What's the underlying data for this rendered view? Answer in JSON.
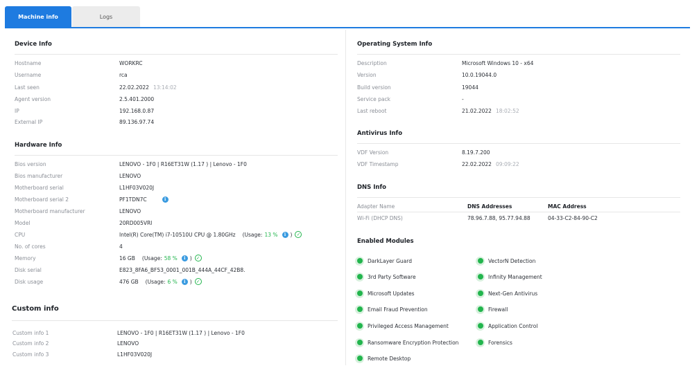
{
  "tabs": [
    {
      "label": "Machine info",
      "active": true
    },
    {
      "label": "Logs",
      "active": false
    }
  ],
  "device": {
    "title": "Device Info",
    "rows": [
      {
        "label": "Hostname",
        "value": "WORKRC"
      },
      {
        "label": "Username",
        "value": "rca"
      },
      {
        "label": "Last seen",
        "value": "22.02.2022",
        "time": "13:14:02"
      },
      {
        "label": "Agent version",
        "value": "2.5.401.2000"
      },
      {
        "label": "IP",
        "value": "192.168.0.87"
      },
      {
        "label": "External IP",
        "value": "89.136.97.74"
      }
    ]
  },
  "hardware": {
    "title": "Hardware Info",
    "rows": [
      {
        "label": "Bios version",
        "value": "LENOVO - 1F0 | R16ET31W (1.17 ) | Lenovo - 1F0"
      },
      {
        "label": "Bios manufacturer",
        "value": "LENOVO"
      },
      {
        "label": "Motherboard serial",
        "value": "L1HF03V020J"
      },
      {
        "label": "Motherboard serial 2",
        "value": "PF1TDN7C"
      },
      {
        "label": "Motherboard manufacturer",
        "value": "LENOVO"
      },
      {
        "label": "Model",
        "value": "20RD005VRI"
      },
      {
        "label": "CPU",
        "value": "Intel(R) Core(TM) i7-10510U CPU @ 1.80GHz",
        "usage_prefix": "(Usage:",
        "usage": "13 %",
        "usage_suffix": ")"
      },
      {
        "label": "No. of cores",
        "value": "4"
      },
      {
        "label": "Memory",
        "value": "16 GB",
        "usage_prefix": "(Usage:",
        "usage": "58 %",
        "usage_suffix": ")"
      },
      {
        "label": "Disk serial",
        "value": "E823_8FA6_BF53_0001_001B_444A_44CF_42B8."
      },
      {
        "label": "Disk usage",
        "value": "476 GB",
        "usage_prefix": "(Usage:",
        "usage": "6 %",
        "usage_suffix": ")"
      }
    ]
  },
  "custom": {
    "title": "Custom info",
    "rows": [
      {
        "label": "Custom info 1",
        "value": "LENOVO - 1F0 | R16ET31W (1.17 ) | Lenovo - 1F0"
      },
      {
        "label": "Custom info 2",
        "value": "LENOVO"
      },
      {
        "label": "Custom info 3",
        "value": "L1HF03V020J"
      }
    ]
  },
  "os": {
    "title": "Operating System Info",
    "rows": [
      {
        "label": "Description",
        "value": "Microsoft Windows 10 - x64"
      },
      {
        "label": "Version",
        "value": "10.0.19044.0"
      },
      {
        "label": "Build version",
        "value": "19044"
      },
      {
        "label": "Service pack",
        "value": "-"
      },
      {
        "label": "Last reboot",
        "value": "21.02.2022",
        "time": "18:02:52"
      }
    ]
  },
  "antivirus": {
    "title": "Antivirus Info",
    "rows": [
      {
        "label": "VDF Version",
        "value": "8.19.7.200"
      },
      {
        "label": "VDF Timestamp",
        "value": "22.02.2022",
        "time": "09:09:22"
      }
    ]
  },
  "dns": {
    "title": "DNS Info",
    "headers": {
      "adapter": "Adapter Name",
      "dns": "DNS Addresses",
      "mac": "MAC Address"
    },
    "row": {
      "adapter": "Wi-Fi (DHCP DNS)",
      "dns": "78.96.7.88, 95.77.94.88",
      "mac": "04-33-C2-84-90-C2"
    }
  },
  "modules": {
    "title": "Enabled Modules",
    "left": [
      "DarkLayer Guard",
      "3rd Party Software",
      "Microsoft Updates",
      "Email Fraud Prevention",
      "Privileged Access Management",
      "Ransomware Encryption Protection",
      "Remote Desktop"
    ],
    "right": [
      "VectorN Detection",
      "Infinity Management",
      "Next-Gen Antivirus",
      "Firewall",
      "Application Control",
      "Forensics"
    ]
  },
  "icons": {
    "info": "info-icon",
    "check": "check-circle-icon",
    "module": "green-dot-icon"
  },
  "colors": {
    "accent": "#1e7be0",
    "success": "#22b54d",
    "info": "#3a9be0"
  }
}
